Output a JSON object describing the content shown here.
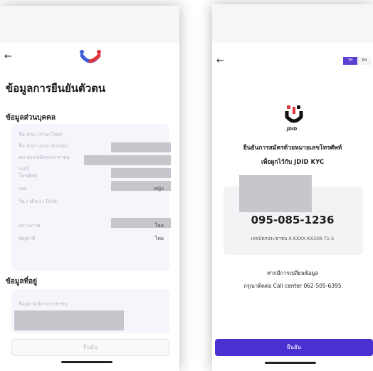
{
  "left_screen": {
    "back_arrow": "←",
    "page_title": "ข้อมูลการยืนยันตัวตน",
    "personal_section": {
      "title": "ข้อมูลส่วนบุคคล",
      "rows": [
        {
          "label": "ชื่อ-สกุล (ภาษาไทย)",
          "value": ""
        },
        {
          "label": "ชื่อ-สกุล (ภาษาอังกฤษ)",
          "value": ""
        },
        {
          "label": "หมายเลขบัตรประชาชน",
          "value": ""
        },
        {
          "label": "เบอร์",
          "value": ""
        },
        {
          "label": "โทรศัพท์",
          "value": ""
        },
        {
          "label": "เพศ",
          "value": "หญิง"
        },
        {
          "label": "วัน / เดือน / ปีเกิด",
          "value": ""
        },
        {
          "label": "สถานภาพ",
          "value": "โสด"
        },
        {
          "label": "สัญชาติ",
          "value": "ไทย"
        }
      ]
    },
    "address_section": {
      "title": "ข้อมูลที่อยู่",
      "address_label": "ที่อยู่ตามบัตรประชาชน"
    },
    "confirm_label": "ยืนยัน"
  },
  "right_screen": {
    "back_arrow": "←",
    "lang_th": "TH",
    "lang_en": "EN",
    "logo_text": "JDID",
    "kyc_line1": "ยืนยันการสมัครด้วยหมายเลขโทรศัพท์",
    "kyc_line2": "เพื่อผูกไว้กับ JDID KYC",
    "phone_number": "095-085-1236",
    "id_line": "เลขบัตรประชาชน X-XXXX-XX338-71-5",
    "change_line1": "หากมีการเปลี่ยนข้อมูล",
    "change_line2": "กรุณาติดต่อ Call center 062-505-6395",
    "confirm_label": "ยืนยัน"
  },
  "colors": {
    "accent": "#4c2fd0",
    "logo_blue": "#3b5bdb",
    "logo_red": "#e0343c",
    "redaction": "#c6c6cc"
  }
}
